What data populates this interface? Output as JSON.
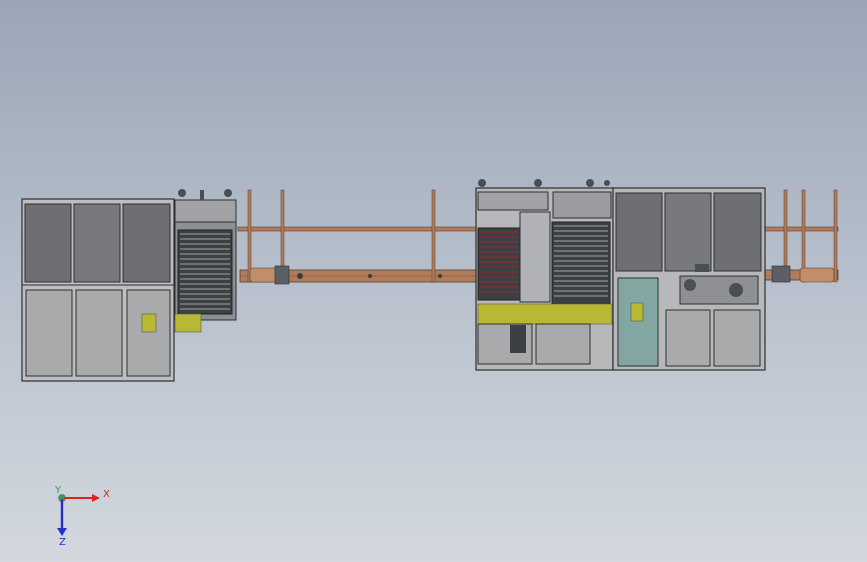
{
  "viewport": {
    "background_top": "#9aa5b6",
    "background_bottom": "#d3d8de"
  },
  "colors": {
    "frame_dark": "#3a3d42",
    "panel_dark": "#6e6f72",
    "panel_light": "#a9aaac",
    "copper": "#b07c5c",
    "copper_dark": "#7a4e34",
    "yellow_olive": "#b8b834",
    "teal_panel": "#82a7a3",
    "red_accent": "#9a2a2a",
    "green_accent": "#2f7d3b"
  },
  "triad": {
    "x_label": "X",
    "y_label": "Y",
    "z_label": "Z",
    "x_color": "#d8261c",
    "y_color": "#2aa33c",
    "z_color": "#2530c6"
  }
}
